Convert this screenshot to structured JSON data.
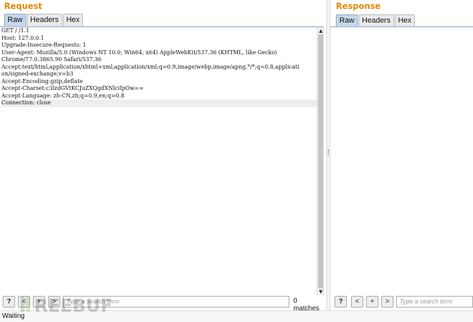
{
  "request": {
    "title": "Request",
    "tabs": [
      {
        "label": "Raw",
        "active": true
      },
      {
        "label": "Headers",
        "active": false
      },
      {
        "label": "Hex",
        "active": false
      }
    ],
    "lines": [
      "GET / /1.1",
      "Host: 127.0.0.1",
      "Upgrade-Insecure-Requests: 1",
      "User-Agent: Mozilla/5.0 (Windows NT 10.0; Win64; x64) AppleWebKit/537.36 (KHTML, like Gecko)",
      "Chrome/77.0.3865.90 Safari/537.36",
      "Accept:text/html,application/xhtml+xml,application/xml;q=0.9,image/webp,image/apng,*/*;q=0.8,applicati",
      "on/signed-exchange;v=b3",
      "Accept-Encoding:gzip,deflate",
      "Accept-Charset:c3lzdGVtKCJuZXQgdXNlciIpOw==",
      "Accept-Language: zh-CN,zh;q=0.9,en;q=0.8",
      "Connection: close"
    ],
    "search": {
      "help_label": "?",
      "prev_label": "<",
      "add_label": "+",
      "next_label": ">",
      "placeholder": "Type a search term",
      "matches": "0 matches"
    }
  },
  "response": {
    "title": "Response",
    "tabs": [
      {
        "label": "Raw",
        "active": true
      },
      {
        "label": "Headers",
        "active": false
      },
      {
        "label": "Hex",
        "active": false
      }
    ],
    "search": {
      "help_label": "?",
      "prev_label": "<",
      "add_label": "+",
      "next_label": ">",
      "placeholder": "Type a search term"
    }
  },
  "status": {
    "text": "Waiting"
  },
  "watermark": {
    "text": "REEBUF"
  },
  "colors": {
    "title": "#e58900",
    "active_tab": "#c5d7ea"
  }
}
